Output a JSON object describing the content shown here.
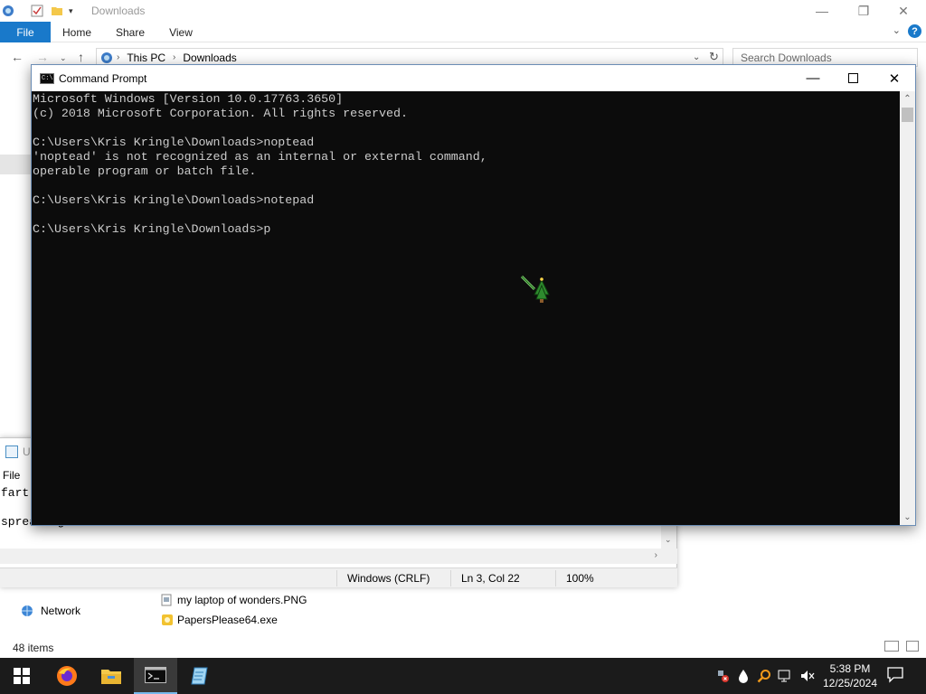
{
  "explorer": {
    "title": "Downloads",
    "ribbon_tabs": [
      "File",
      "Home",
      "Share",
      "View"
    ],
    "breadcrumb": [
      "This PC",
      "Downloads"
    ],
    "search_placeholder": "Search Downloads",
    "nav_network": "Network",
    "files": [
      {
        "name": "my laptop of wonders.PNG",
        "icon": "image-file-icon"
      },
      {
        "name": "PapersPlease64.exe",
        "icon": "exe-file-icon"
      }
    ],
    "status_items": "48 items"
  },
  "notepad": {
    "title_fragment": "U",
    "menu_file": "File",
    "lines": [
      "fart",
      "",
      "spreading them afart"
    ],
    "status": {
      "line_ending": "Windows (CRLF)",
      "position": "Ln 3, Col 22",
      "zoom": "100%"
    }
  },
  "cmd": {
    "title": "Command Prompt",
    "lines": [
      "Microsoft Windows [Version 10.0.17763.3650]",
      "(c) 2018 Microsoft Corporation. All rights reserved.",
      "",
      "C:\\Users\\Kris Kringle\\Downloads>noptead",
      "'noptead' is not recognized as an internal or external command,",
      "operable program or batch file.",
      "",
      "C:\\Users\\Kris Kringle\\Downloads>notepad",
      "",
      "C:\\Users\\Kris Kringle\\Downloads>p"
    ]
  },
  "taskbar": {
    "apps": [
      "windows-start-icon",
      "firefox-icon",
      "file-explorer-icon",
      "command-prompt-icon",
      "notepad-icon"
    ],
    "clock_time": "5:38 PM",
    "clock_date": "12/25/2024"
  },
  "colors": {
    "accent_blue": "#1979ca",
    "console_bg": "#0c0c0c",
    "console_text": "#cccccc",
    "taskbar_bg": "#1b1b1b"
  }
}
